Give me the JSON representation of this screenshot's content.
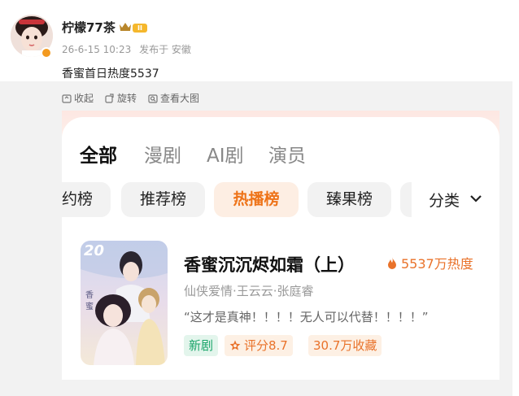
{
  "post": {
    "username": "柠檬77茶",
    "level": "II",
    "time": "26-6-15 10:23",
    "source": "发布于 安徽",
    "text": "香蜜首日热度5537",
    "actions": [
      {
        "label": "收起",
        "icon": "collapse-icon"
      },
      {
        "label": "旋转",
        "icon": "rotate-icon"
      },
      {
        "label": "查看大图",
        "icon": "view-large-icon"
      }
    ]
  },
  "app": {
    "tabs": [
      "全部",
      "漫剧",
      "AI剧",
      "演员"
    ],
    "active_tab": "全部",
    "chips": [
      "约榜",
      "推荐榜",
      "热播榜",
      "臻果榜"
    ],
    "active_chip": "热播榜",
    "category_label": "分类",
    "item": {
      "rank": "20",
      "title": "香蜜沉沉烬如霜（上）",
      "heat": "5537万热度",
      "tags": "仙侠爱情·王云云·张庭睿",
      "quote": "“这才是真神！！！！无人可以代替！！！！”",
      "badge_new": "新剧",
      "score": "评分8.7",
      "favorites": "30.7万收藏"
    }
  },
  "colors": {
    "accent_orange": "#e9722a",
    "green": "#1aa56a",
    "level_gold": "#f5b72c"
  }
}
